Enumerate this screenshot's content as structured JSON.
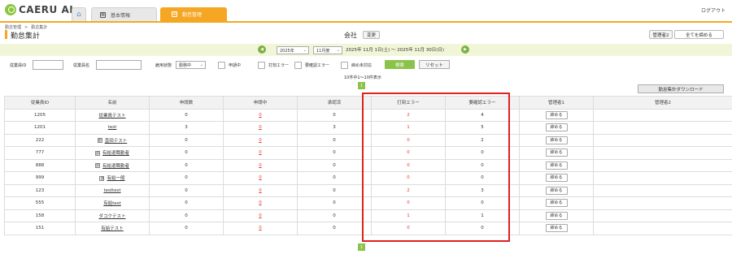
{
  "header": {
    "logo_text": "CAERU AI",
    "tabs": [
      {
        "label": "基本情報",
        "icon": "grid-icon"
      },
      {
        "label": "勤怠管理",
        "icon": "calendar-icon",
        "active": true
      }
    ],
    "logout": "ログアウト",
    "accent_color": "#f5a623"
  },
  "breadcrumb": [
    "勤怠管理",
    ">",
    "勤怠集計"
  ],
  "page_title": "勤怠集計",
  "company": {
    "name": "会社",
    "change_label": "変更"
  },
  "admin": {
    "admin2_label": "管理者2",
    "close_all_label": "全てを締める"
  },
  "month_bar": {
    "year": "2025年",
    "month": "11月度",
    "period": "2025年 11月 1日(土) 〜 2025年 11月 30日(日)",
    "prev": "◀",
    "next": "▶"
  },
  "filters": {
    "employee_id_label": "従業員ID",
    "employee_name_label": "従業員名",
    "employment_status_label": "雇用状態",
    "employment_status_value": "勤務中",
    "checks": [
      "申請中",
      "打刻エラー",
      "要確認エラー",
      "締め未対応"
    ],
    "search_label": "検索",
    "reset_label": "リセット"
  },
  "result_count": "10件中1〜10件表示",
  "page": "1",
  "download_label": "勤怠集計ダウンロード",
  "table": {
    "headers": [
      "従業員ID",
      "名前",
      "申請数",
      "申請中",
      "承認済",
      "打刻エラー",
      "要確認エラー",
      "管理者1",
      "管理者2"
    ],
    "close_label": "締める",
    "rows": [
      {
        "id": "1205",
        "name": "従業員テスト",
        "dept": false,
        "applications": "0",
        "pending": "0",
        "approved": "0",
        "punch_error": "2",
        "check_error": "4"
      },
      {
        "id": "1201",
        "name": "test",
        "dept": false,
        "applications": "3",
        "pending": "0",
        "approved": "3",
        "punch_error": "1",
        "check_error": "5"
      },
      {
        "id": "222",
        "name": "直田テスト",
        "dept": true,
        "applications": "0",
        "pending": "0",
        "approved": "0",
        "punch_error": "0",
        "check_error": "2"
      },
      {
        "id": "777",
        "name": "有給退職勤者",
        "dept": true,
        "applications": "0",
        "pending": "0",
        "approved": "0",
        "punch_error": "0",
        "check_error": "0"
      },
      {
        "id": "888",
        "name": "有給退職勤者",
        "dept": true,
        "applications": "0",
        "pending": "0",
        "approved": "0",
        "punch_error": "0",
        "check_error": "0"
      },
      {
        "id": "999",
        "name": "有給一般",
        "dept": true,
        "applications": "0",
        "pending": "0",
        "approved": "0",
        "punch_error": "0",
        "check_error": "0"
      },
      {
        "id": "123",
        "name": "testtest",
        "dept": false,
        "applications": "0",
        "pending": "0",
        "approved": "0",
        "punch_error": "2",
        "check_error": "3"
      },
      {
        "id": "555",
        "name": "有給test",
        "dept": false,
        "applications": "0",
        "pending": "0",
        "approved": "0",
        "punch_error": "0",
        "check_error": "0"
      },
      {
        "id": "158",
        "name": "ダコクテスト",
        "dept": false,
        "applications": "0",
        "pending": "0",
        "approved": "0",
        "punch_error": "1",
        "check_error": "1"
      },
      {
        "id": "151",
        "name": "有給テスト",
        "dept": false,
        "applications": "0",
        "pending": "0",
        "approved": "0",
        "punch_error": "0",
        "check_error": "0"
      }
    ]
  }
}
